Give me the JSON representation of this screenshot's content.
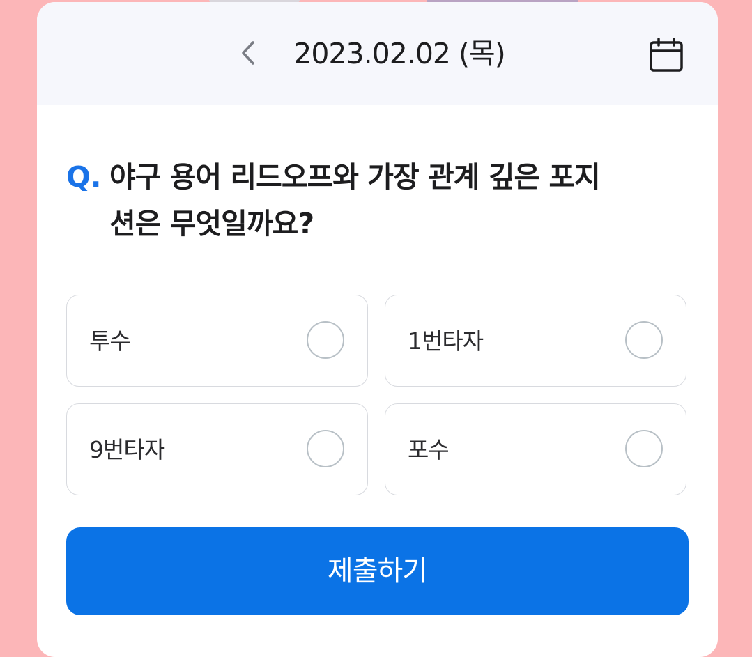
{
  "date_bar": {
    "prev_icon": "chevron-left-icon",
    "date": "2023.02.02 (목)",
    "calendar_icon": "calendar-icon"
  },
  "quiz": {
    "q_prefix": "Q.",
    "question_line1": "야구 용어 리드오프와 가장 관계 깊은 포지",
    "question_line2": "션은 무엇일까요?",
    "options": [
      {
        "label": "투수",
        "selected": false
      },
      {
        "label": "1번타자",
        "selected": false
      },
      {
        "label": "9번타자",
        "selected": false
      },
      {
        "label": "포수",
        "selected": false
      }
    ],
    "submit_label": "제출하기"
  },
  "colors": {
    "background": "#fcb6b8",
    "accent": "#0b73e6",
    "q_mark": "#1a73e8",
    "date_bar": "#f6f7fc"
  }
}
